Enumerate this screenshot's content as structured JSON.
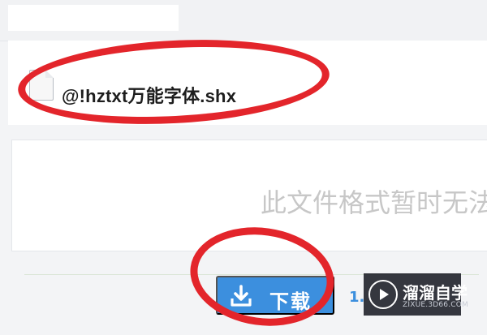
{
  "file": {
    "name": "@!hztxt万能字体.shx"
  },
  "preview": {
    "message": "此文件格式暂时无法"
  },
  "actions": {
    "download_label": "下载",
    "page_hint": "1."
  },
  "watermark": {
    "title": "溜溜自学",
    "url": "ZIXUE.3D66.COM"
  },
  "colors": {
    "annotation": "#e3252b",
    "button": "#3c8fde",
    "watermark_bg": "#1a1c26"
  }
}
